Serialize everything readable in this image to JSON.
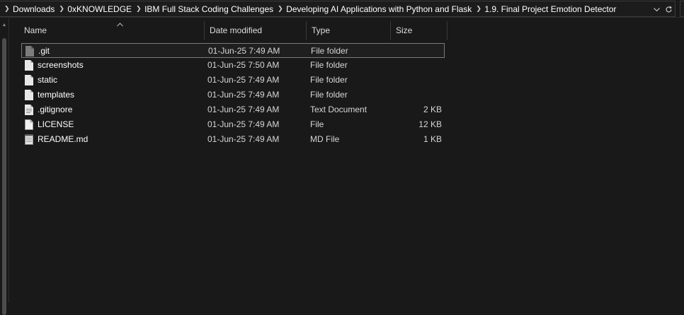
{
  "breadcrumb": {
    "items": [
      "Downloads",
      "0xKNOWLEDGE",
      "IBM Full Stack Coding Challenges",
      "Developing AI Applications with Python and Flask",
      "1.9. Final Project Emotion Detector"
    ],
    "actions": {
      "dropdown_icon": "chevron-down-icon",
      "refresh_icon": "refresh-icon"
    }
  },
  "columns": {
    "name": "Name",
    "date": "Date modified",
    "type": "Type",
    "size": "Size"
  },
  "files": [
    {
      "name": ".git",
      "date": "01-Jun-25 7:49 AM",
      "type": "File folder",
      "size": "",
      "icon": "folder-icon",
      "selected": true
    },
    {
      "name": "screenshots",
      "date": "01-Jun-25 7:50 AM",
      "type": "File folder",
      "size": "",
      "icon": "folder-icon",
      "selected": false
    },
    {
      "name": "static",
      "date": "01-Jun-25 7:49 AM",
      "type": "File folder",
      "size": "",
      "icon": "folder-icon",
      "selected": false
    },
    {
      "name": "templates",
      "date": "01-Jun-25 7:49 AM",
      "type": "File folder",
      "size": "",
      "icon": "folder-icon",
      "selected": false
    },
    {
      "name": ".gitignore",
      "date": "01-Jun-25 7:49 AM",
      "type": "Text Document",
      "size": "2 KB",
      "icon": "text-file-icon",
      "selected": false
    },
    {
      "name": "LICENSE",
      "date": "01-Jun-25 7:49 AM",
      "type": "File",
      "size": "12 KB",
      "icon": "blank-file-icon",
      "selected": false
    },
    {
      "name": "README.md",
      "date": "01-Jun-25 7:49 AM",
      "type": "MD File",
      "size": "1 KB",
      "icon": "notepad-file-icon",
      "selected": false
    }
  ],
  "colors": {
    "background": "#191919",
    "text": "#ffffff",
    "muted_text": "#d6d6d6",
    "selection_border": "#7a7a7a",
    "scrollbar": "#4d4d4d"
  }
}
